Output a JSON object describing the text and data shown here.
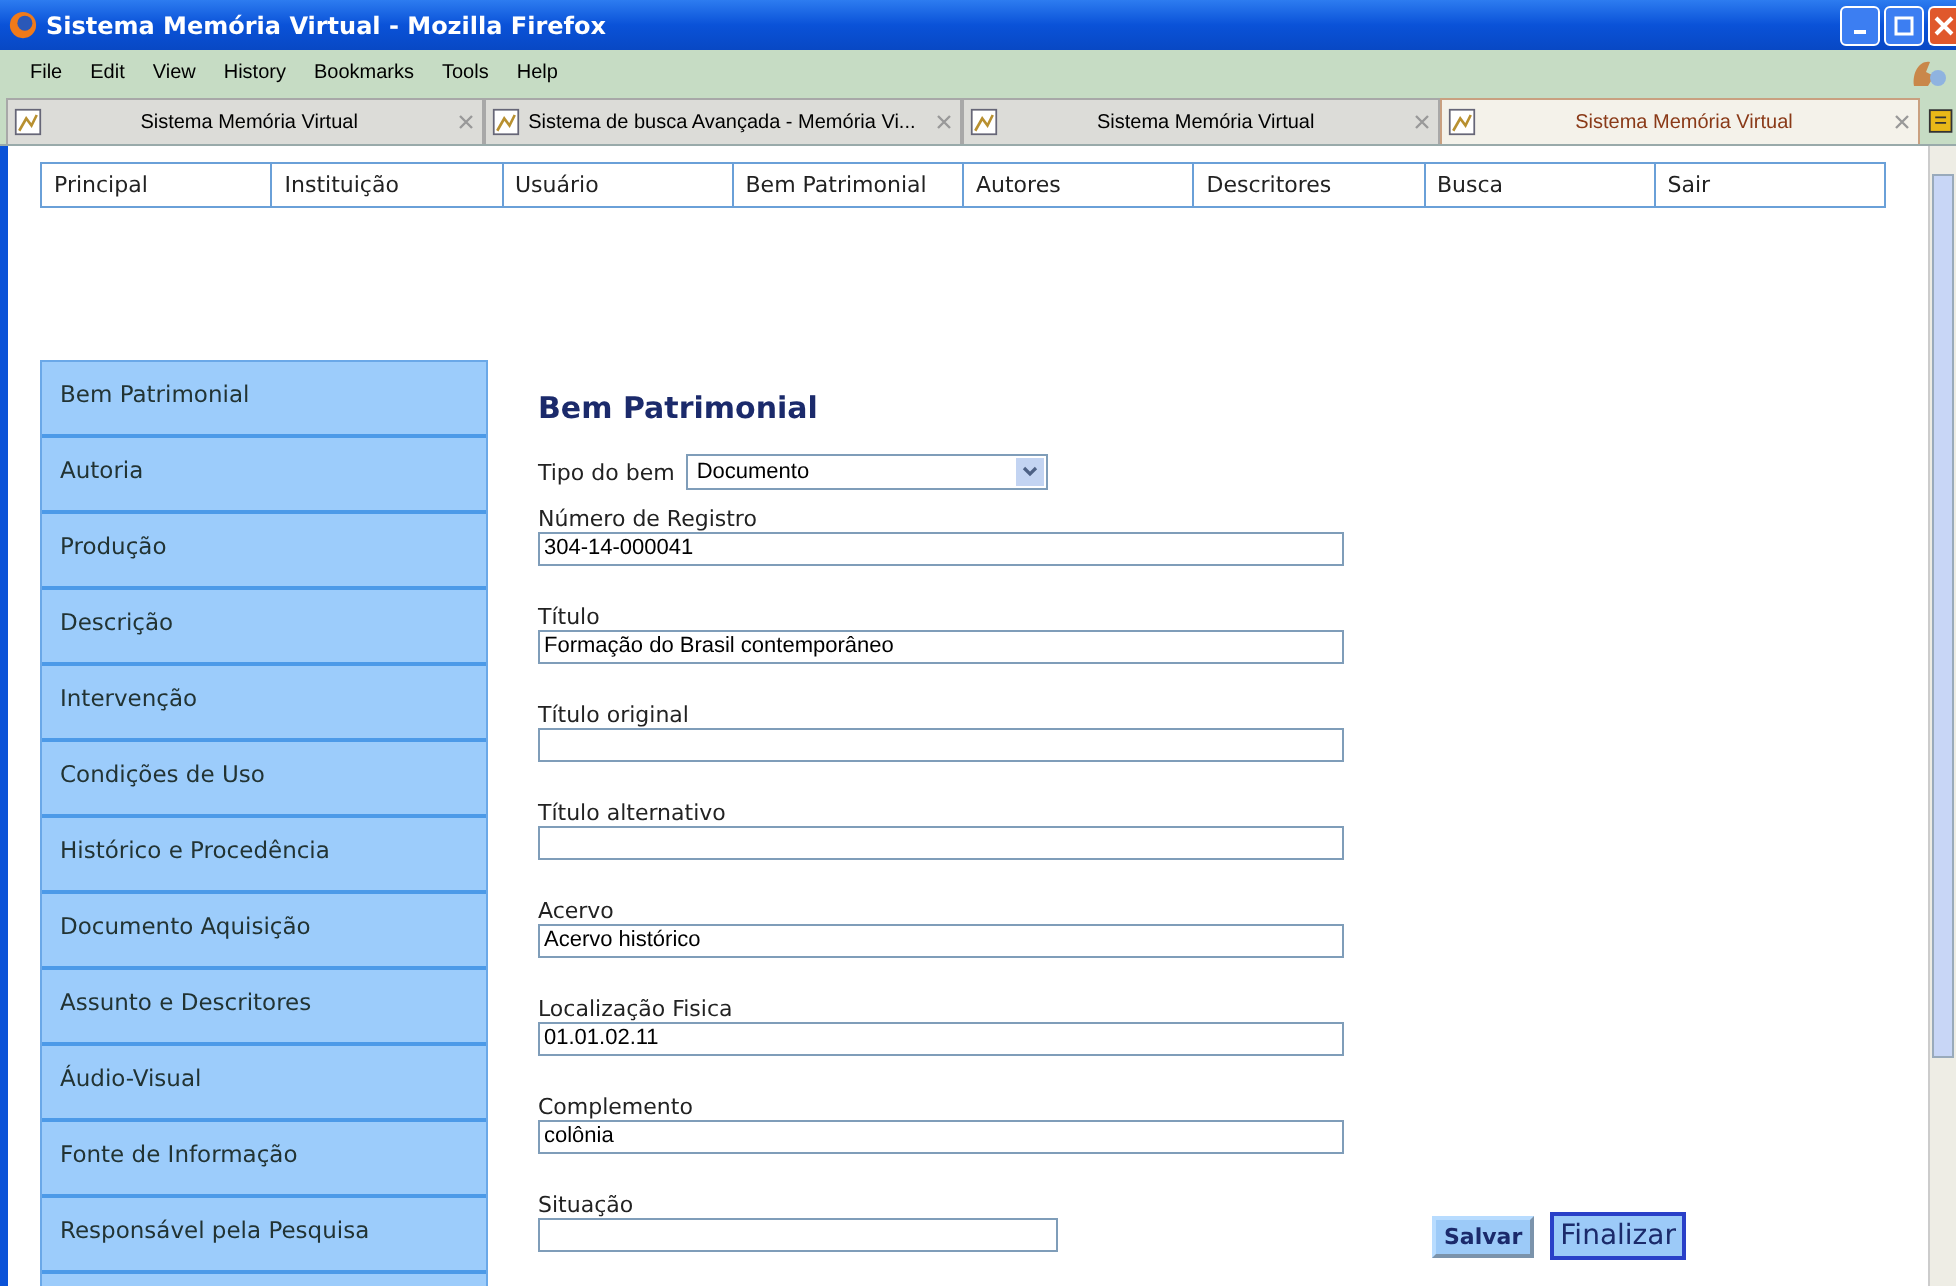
{
  "window": {
    "title": "Sistema Memória Virtual - Mozilla Firefox"
  },
  "menu": [
    "File",
    "Edit",
    "View",
    "History",
    "Bookmarks",
    "Tools",
    "Help"
  ],
  "tabs": [
    {
      "label": "Sistema Memória Virtual",
      "selected": false
    },
    {
      "label": "Sistema de busca Avançada - Memória Vi...",
      "selected": false
    },
    {
      "label": "Sistema Memória Virtual",
      "selected": false
    },
    {
      "label": "Sistema Memória Virtual",
      "selected": true
    }
  ],
  "nav": [
    "Principal",
    "Instituição",
    "Usuário",
    "Bem Patrimonial",
    "Autores",
    "Descritores",
    "Busca",
    "Sair"
  ],
  "sidebar": {
    "items": [
      "Bem Patrimonial",
      "Autoria",
      "Produção",
      "Descrição",
      "Intervenção",
      "Condições de Uso",
      "Histórico e Procedência",
      "Documento Aquisição",
      "Assunto e Descritores",
      "Áudio-Visual",
      "Fonte de Informação",
      "Responsável pela Pesquisa"
    ]
  },
  "form": {
    "heading": "Bem Patrimonial",
    "type_field": {
      "label": "Tipo do bem",
      "value": "Documento"
    },
    "fields": [
      {
        "label": "Número de Registro",
        "value": "304-14-000041",
        "kind": "text"
      },
      {
        "label": "Título",
        "value": "Formação do Brasil contemporâneo",
        "kind": "text"
      },
      {
        "label": "Título original",
        "kind": "text"
      },
      {
        "label": "Título alternativo",
        "kind": "text"
      },
      {
        "label": "Acervo",
        "value": "Acervo histórico",
        "kind": "text"
      },
      {
        "label": "Localização Fisica",
        "value": "01.01.02.11",
        "kind": "text"
      },
      {
        "label": "Complemento",
        "value": "colônia",
        "kind": "text"
      },
      {
        "label": "Situação",
        "kind": "select"
      }
    ],
    "buttons": [
      {
        "label": "Salvar",
        "kind": "small"
      },
      {
        "label": "Finalizar",
        "kind": "large"
      }
    ]
  }
}
